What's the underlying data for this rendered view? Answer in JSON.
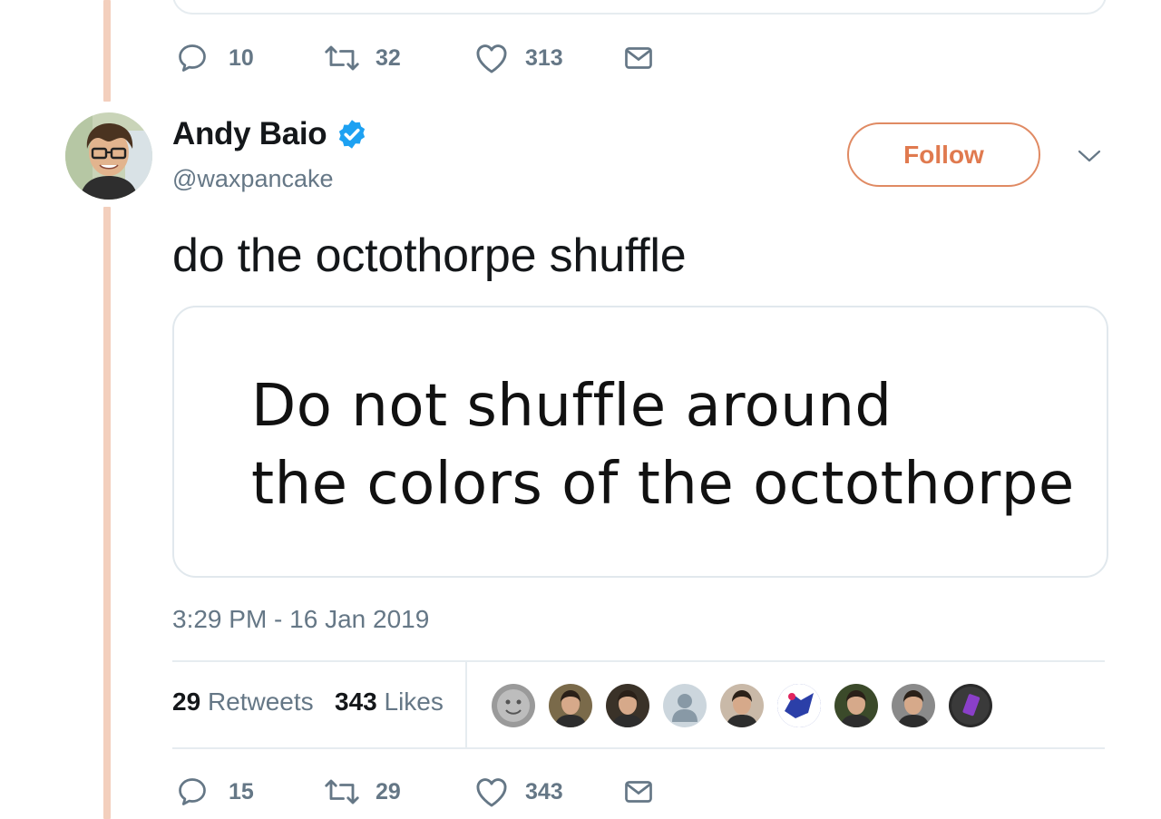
{
  "previous_tweet": {
    "reply_count": "10",
    "retweet_count": "32",
    "like_count": "313"
  },
  "tweet": {
    "author_name": "Andy Baio",
    "author_handle": "@waxpancake",
    "verified": true,
    "follow_label": "Follow",
    "text": "do the octothorpe shuffle",
    "card_lines": [
      "Do not shuffle around",
      "the colors of the octothorpe"
    ],
    "timestamp": "3:29 PM - 16 Jan 2019",
    "retweets_count": "29",
    "retweets_label": "Retweets",
    "likes_count": "343",
    "likes_label": "Likes",
    "reply_count": "15",
    "retweet_count": "29",
    "like_count": "343"
  },
  "likers": [
    {
      "icon": "avatar-moon-face",
      "color": "#9a9a9a"
    },
    {
      "icon": "avatar-man-brown",
      "color": "#7a6a4a"
    },
    {
      "icon": "avatar-dark-portrait",
      "color": "#3a3228"
    },
    {
      "icon": "avatar-default-silhouette",
      "color": "#ccd6dd"
    },
    {
      "icon": "avatar-man-glasses",
      "color": "#c9b9a8"
    },
    {
      "icon": "avatar-blue-logo",
      "color": "#2b3fa8"
    },
    {
      "icon": "avatar-man-beard",
      "color": "#3b4a2a"
    },
    {
      "icon": "avatar-man-light",
      "color": "#8a8a8a"
    },
    {
      "icon": "avatar-phone-logo",
      "color": "#2a2a2a"
    }
  ],
  "colors": {
    "thread_line": "#f3cfbd",
    "follow_accent": "#e07a4f",
    "verified_badge": "#1da1f2",
    "secondary_text": "#657786"
  }
}
